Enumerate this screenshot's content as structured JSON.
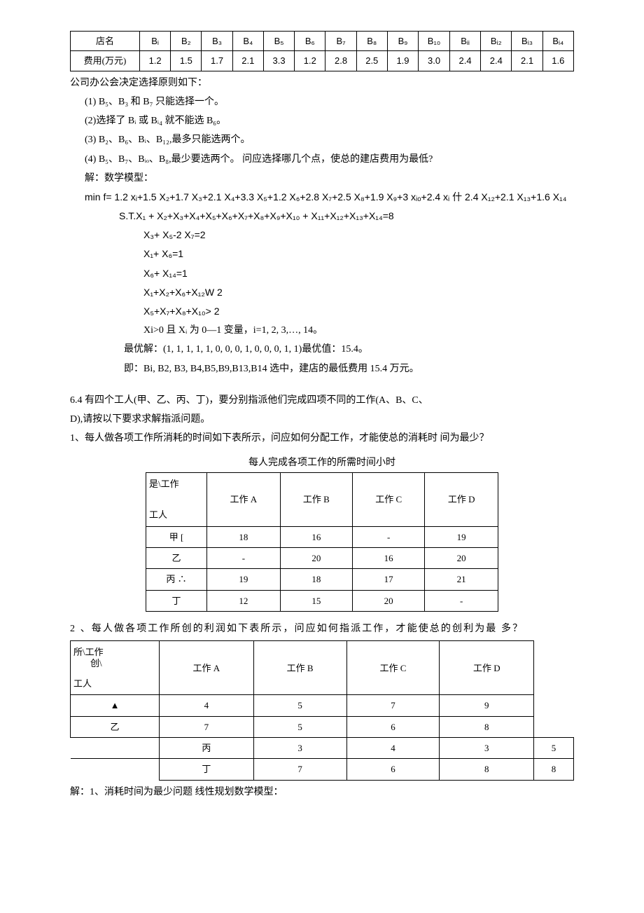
{
  "table1": {
    "row1_label": "店名",
    "row2_label": "费用(万元)",
    "headers": [
      "Bᵢ",
      "B₂",
      "B₃",
      "B₄",
      "B₅",
      "B₆",
      "B₇",
      "B₈",
      "B₉",
      "B₁₀",
      "Bᵢᵢ",
      "Bᵢ₂",
      "Bᵢ₃",
      "Bᵢ₄"
    ],
    "costs": [
      "1.2",
      "1.5",
      "1.7",
      "2.1",
      "3.3",
      "1.2",
      "2.8",
      "2.5",
      "1.9",
      "3.0",
      "2.4",
      "2.4",
      "2.1",
      "1.6"
    ]
  },
  "text": {
    "p1": "公司办公会决定选择原则如下：",
    "p2": "(1)   B₅、B₃ 和 B₇ 只能选择一个。",
    "p3": "(2)选择了 Bᵢ 或 Bᵢ₄ 就不能选 B₆。",
    "p4": "(3)   B₂、B₆、Bᵢ、B₁₂,最多只能选两个。",
    "p5": "(4)   B₅、B₇、Bᵢₒ、B₈,最少要选两个。  问应选择哪几个点，使总的建店费用为最低?",
    "p6": "解：数学模型：",
    "p7": "min f= 1.2 xᵢ+1.5 X₂+1.7 X₃+2.1 X₄+3.3 X₅+1.2 X₆+2.8 X₇+2.5 X₈+1.9 X₉+3 xᵢₒ+2.4 xᵢ 什 2.4 X₁₂+2.1 X₁₃+1.6 X₁₄",
    "p8": "S.T.X₁ + X₂+X₃+X₄+X₅+X₆+X₇+X₈+X₉+X₁₀ + X₁₁+X₁₂+X₁₃+X₁₄=8",
    "p9": "X₃+ X₅-2 X₇=2",
    "p10": "X₁+ X₆=1",
    "p11": "X₆+ X₁₄=1",
    "p12": "X₁+X₂+X₆+X₁₂W 2",
    "p13": "X₅+X₇+X₈+X₁₀> 2",
    "p14": "Xi>0 且 Xᵢ 为 0—1 变量，i=1, 2, 3,…,   14。",
    "p15": "最优解：(1, 1, 1, 1, 1, 0, 0, 0, 1, 0, 0, 0, 1, 1)最优值：15.4。",
    "p16": "即：Bi, B2, B3, B4,B5,B9,B13,B14 选中，建店的最低费用 15.4 万元。",
    "p17": "6.4 有四个工人(甲、乙、丙、丁)，要分别指派他们完成四项不同的工作(A、B、C、",
    "p18": "D),请按以下要求求解指派问题。",
    "p19": "1、每人做各项工作所消耗的时间如下表所示，问应如何分配工作，才能使总的消耗时  间为最少？",
    "caption1": "每人完成各项工作的所需时间小时",
    "p20": "2 、每人做各项工作所创的利润如下表所示，问应如何指派工作，才能使总的创利为最   多？",
    "p21": "解：1、消耗时间为最少问题  线性规划数学模型："
  },
  "table2": {
    "hdr_top": "是\\工作",
    "hdr_bot": "工人",
    "cols": [
      "工作 A",
      "工作 B",
      "工作 C",
      "工作 D"
    ],
    "rows": [
      {
        "name": "甲 [",
        "v": [
          "18",
          "16",
          "-",
          "19"
        ]
      },
      {
        "name": "乙",
        "v": [
          "-",
          "20",
          "16",
          "20"
        ]
      },
      {
        "name": "丙 ∴",
        "v": [
          "19",
          "18",
          "17",
          "21"
        ]
      },
      {
        "name": "丁",
        "v": [
          "12",
          "15",
          "20",
          "-"
        ]
      }
    ]
  },
  "table3": {
    "hdr_l1": "所\\工作",
    "hdr_l2": "创\\",
    "hdr_l3": "工人",
    "cols": [
      "工作 A",
      "工作 B",
      "工作 C",
      "工作 D"
    ],
    "rows": [
      {
        "name": "▲",
        "v": [
          "4",
          "5",
          "7",
          "9"
        ]
      },
      {
        "name": "乙",
        "v": [
          "7",
          "5",
          "6",
          "8"
        ]
      },
      {
        "name": "丙",
        "v": [
          "3",
          "4",
          "3",
          "5"
        ]
      },
      {
        "name": "丁",
        "v": [
          "7",
          "6",
          "8",
          "8"
        ]
      }
    ]
  }
}
